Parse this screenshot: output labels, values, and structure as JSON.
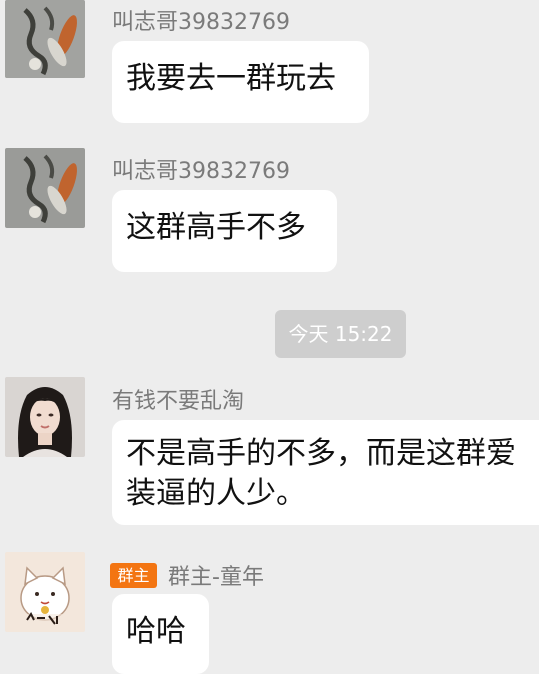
{
  "messages": [
    {
      "sender": "叫志哥39832769",
      "text": "我要去一群玩去",
      "avatar": "cats-on-gray-avatar"
    },
    {
      "sender": "叫志哥39832769",
      "text": "这群高手不多",
      "avatar": "cats-on-gray-avatar"
    },
    {
      "sender": "有钱不要乱淘",
      "text_line1": "不是高手的不多，而是这群爱",
      "text_line2": "装逼的人少。",
      "avatar": "woman-portrait-avatar"
    },
    {
      "sender": "群主-童年",
      "badge": "群主",
      "text": "哈哈",
      "avatar": "lucky-cat-avatar"
    }
  ],
  "timestamp": "今天 15:22",
  "colors": {
    "background": "#ededed",
    "bubble": "#ffffff",
    "badge": "#f37512",
    "time_chip": "#cecece"
  }
}
